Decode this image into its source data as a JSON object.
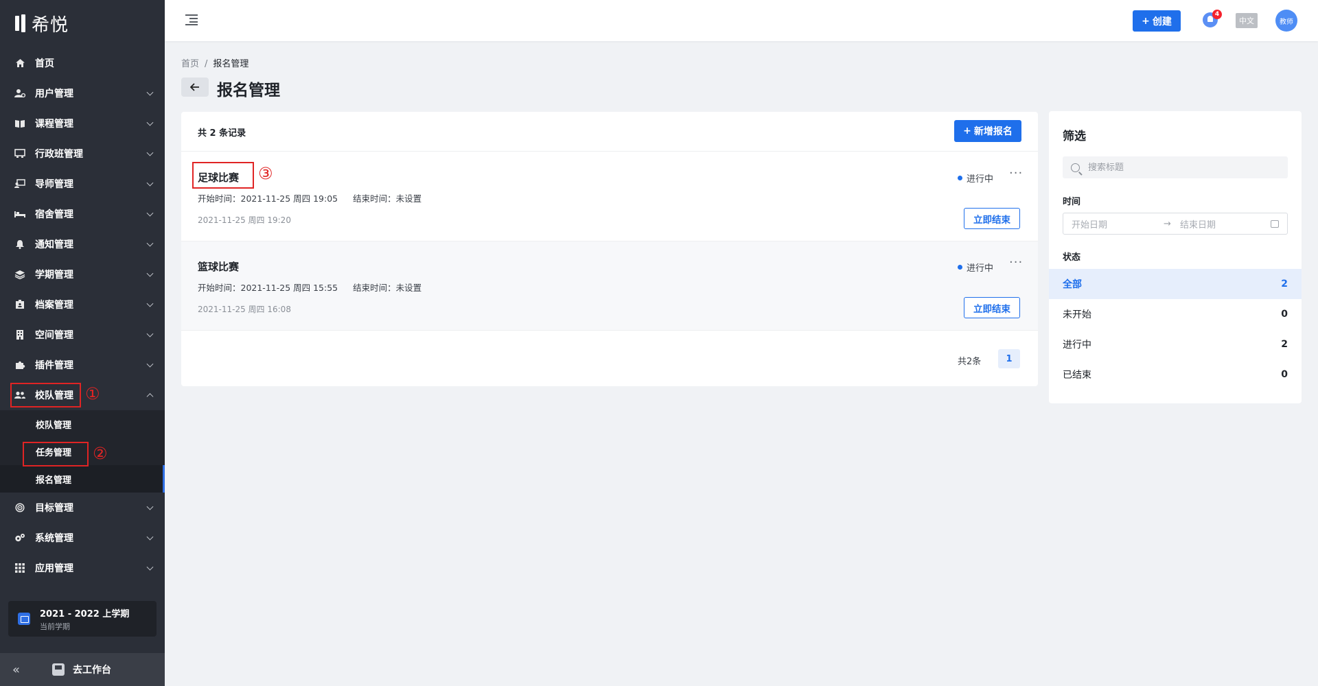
{
  "brand": {
    "name": "希悦"
  },
  "sidebar": {
    "items": [
      {
        "label": "首页",
        "icon": "home-icon"
      },
      {
        "label": "用户管理",
        "icon": "user-icon"
      },
      {
        "label": "课程管理",
        "icon": "book-icon"
      },
      {
        "label": "行政班管理",
        "icon": "class-icon"
      },
      {
        "label": "导师管理",
        "icon": "mentor-icon"
      },
      {
        "label": "宿舍管理",
        "icon": "bed-icon"
      },
      {
        "label": "通知管理",
        "icon": "bell-icon"
      },
      {
        "label": "学期管理",
        "icon": "layers-icon"
      },
      {
        "label": "档案管理",
        "icon": "archive-icon"
      },
      {
        "label": "空间管理",
        "icon": "building-icon"
      },
      {
        "label": "插件管理",
        "icon": "puzzle-icon"
      },
      {
        "label": "校队管理",
        "icon": "team-icon"
      }
    ],
    "subitems": [
      {
        "label": "校队管理"
      },
      {
        "label": "任务管理"
      },
      {
        "label": "报名管理"
      }
    ],
    "items_after": [
      {
        "label": "目标管理",
        "icon": "target-icon"
      },
      {
        "label": "系统管理",
        "icon": "settings-icon"
      },
      {
        "label": "应用管理",
        "icon": "apps-icon"
      }
    ],
    "term": {
      "title": "2021 - 2022 上学期",
      "subtitle": "当前学期"
    },
    "workspace_label": "去工作台",
    "annotations": [
      "①",
      "②"
    ]
  },
  "header": {
    "create_label": "创建",
    "notification_count": "4",
    "language": "中文",
    "avatar_text": "教师"
  },
  "breadcrumb": {
    "home": "首页",
    "separator": "/",
    "current": "报名管理"
  },
  "page": {
    "title": "报名管理"
  },
  "list": {
    "count_label": "共 2 条记录",
    "add_label": "新增报名",
    "annotation": "③",
    "rows": [
      {
        "title": "足球比赛",
        "start": "开始时间：2021-11-25 周四 19:05",
        "end": "结束时间：未设置",
        "created": "2021-11-25 周四 19:20",
        "status": "进行中",
        "action": "立即结束"
      },
      {
        "title": "篮球比赛",
        "start": "开始时间：2021-11-25 周四 15:55",
        "end": "结束时间：未设置",
        "created": "2021-11-25 周四 16:08",
        "status": "进行中",
        "action": "立即结束"
      }
    ],
    "pager": {
      "total": "共2条",
      "page": "1"
    }
  },
  "filter": {
    "title": "筛选",
    "search_placeholder": "搜索标题",
    "time_label": "时间",
    "start_placeholder": "开始日期",
    "arrow": "→",
    "end_placeholder": "结束日期",
    "status_label": "状态",
    "options": [
      {
        "label": "全部",
        "count": "2"
      },
      {
        "label": "未开始",
        "count": "0"
      },
      {
        "label": "进行中",
        "count": "2"
      },
      {
        "label": "已结束",
        "count": "0"
      }
    ]
  },
  "colors": {
    "accent": "#1f6feb",
    "sidebar": "#2b2f38",
    "annotation": "#e02424"
  }
}
